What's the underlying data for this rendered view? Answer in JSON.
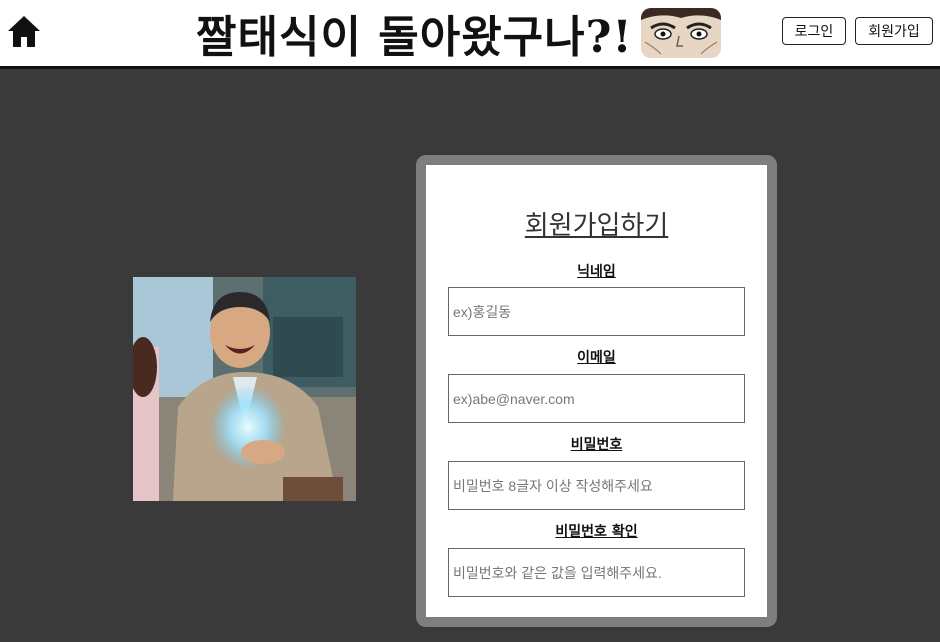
{
  "header": {
    "title": "짤태식이 돌아왔구나?!",
    "login_label": "로그인",
    "signup_label": "회원가입"
  },
  "signup_form": {
    "title": "회원가입하기",
    "fields": [
      {
        "label": "닉네임",
        "value": "",
        "placeholder": "ex)홍길동"
      },
      {
        "label": "이메일",
        "value": "",
        "placeholder": "ex)abe@naver.com"
      },
      {
        "label": "비밀번호",
        "value": "",
        "placeholder": "비밀번호 8글자 이상 작성해주세요"
      },
      {
        "label": "비밀번호 확인",
        "value": "",
        "placeholder": "비밀번호와 같은 값을 입력해주세요."
      }
    ]
  },
  "icons": {
    "home": "home-icon",
    "face": "manga-face-icon"
  },
  "colors": {
    "background": "#3a3a3a",
    "panel_border": "#7e7e7e",
    "header_bg": "#ffffff"
  }
}
